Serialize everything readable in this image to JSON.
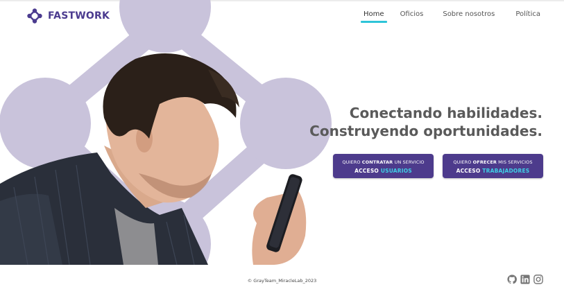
{
  "brand": {
    "name": "FASTWORK"
  },
  "nav": {
    "items": [
      {
        "label": "Home",
        "active": true
      },
      {
        "label": "Oficios",
        "active": false
      },
      {
        "label": "Sobre nosotros",
        "active": false
      },
      {
        "label": "Política",
        "active": false
      }
    ]
  },
  "hero": {
    "title_line1": "Conectando habilidades.",
    "title_line2": "Construyendo oportunidades."
  },
  "cta_users": {
    "pre": "QUIERO ",
    "bold": "CONTRATAR",
    "post": " UN SERVICIO",
    "access": "ACCESO ",
    "target": "USUARIOS"
  },
  "cta_workers": {
    "pre": "QUIERO ",
    "bold": "OFRECER",
    "post": " MIS SERVICIOS",
    "access": "ACCESO ",
    "target": "TRABAJADORES"
  },
  "footer": {
    "copyright": "© GrayTeam_MiracleLab_2023",
    "social": [
      "github-icon",
      "linkedin-icon",
      "instagram-icon"
    ]
  },
  "colors": {
    "brand": "#4b3b8f",
    "accent": "#2ec4d8",
    "shape": "#c9c3db",
    "button": "#4d3b8c"
  }
}
